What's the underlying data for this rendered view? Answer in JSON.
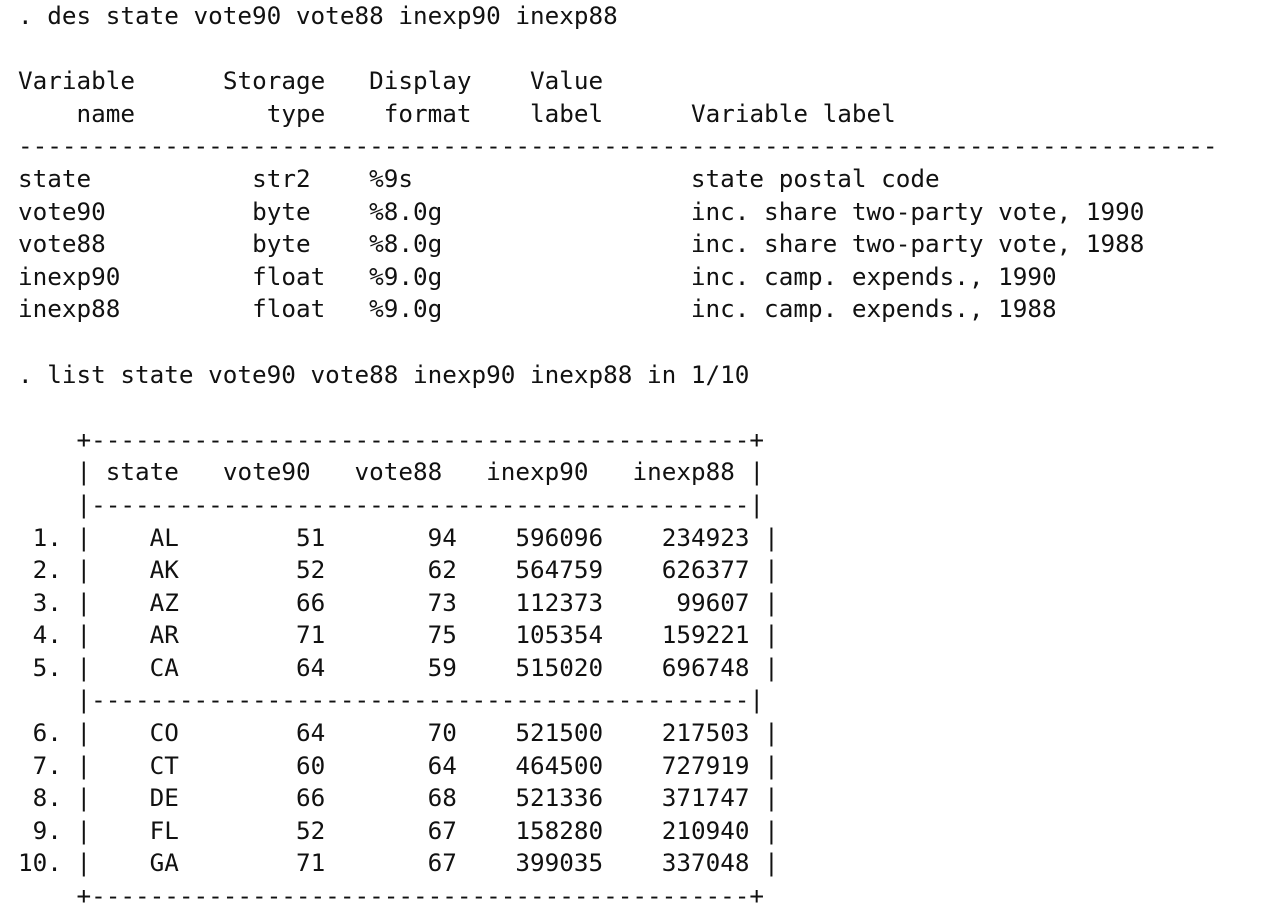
{
  "describe_command": ". des state vote90 vote88 inexp90 inexp88",
  "describe_table": {
    "headers": {
      "variable_name": [
        "Variable",
        "name"
      ],
      "storage_type": [
        "Storage",
        "type"
      ],
      "display_format": [
        "Display",
        "format"
      ],
      "value_label": [
        "Value",
        "label"
      ],
      "variable_label": [
        "",
        "Variable label"
      ]
    },
    "rows": [
      {
        "name": "state",
        "type": "str2",
        "format": "%9s",
        "value_label": "",
        "label": "state postal code"
      },
      {
        "name": "vote90",
        "type": "byte",
        "format": "%8.0g",
        "value_label": "",
        "label": "inc. share two-party vote, 1990"
      },
      {
        "name": "vote88",
        "type": "byte",
        "format": "%8.0g",
        "value_label": "",
        "label": "inc. share two-party vote, 1988"
      },
      {
        "name": "inexp90",
        "type": "float",
        "format": "%9.0g",
        "value_label": "",
        "label": "inc. camp. expends., 1990"
      },
      {
        "name": "inexp88",
        "type": "float",
        "format": "%9.0g",
        "value_label": "",
        "label": "inc. camp. expends., 1988"
      }
    ]
  },
  "list_command": ". list state vote90 vote88 inexp90 inexp88 in 1/10",
  "list_table": {
    "columns": [
      "state",
      "vote90",
      "vote88",
      "inexp90",
      "inexp88"
    ],
    "rows": [
      {
        "obs": "1.",
        "state": "AL",
        "vote90": "51",
        "vote88": "94",
        "inexp90": "596096",
        "inexp88": "234923"
      },
      {
        "obs": "2.",
        "state": "AK",
        "vote90": "52",
        "vote88": "62",
        "inexp90": "564759",
        "inexp88": "626377"
      },
      {
        "obs": "3.",
        "state": "AZ",
        "vote90": "66",
        "vote88": "73",
        "inexp90": "112373",
        "inexp88": "99607"
      },
      {
        "obs": "4.",
        "state": "AR",
        "vote90": "71",
        "vote88": "75",
        "inexp90": "105354",
        "inexp88": "159221"
      },
      {
        "obs": "5.",
        "state": "CA",
        "vote90": "64",
        "vote88": "59",
        "inexp90": "515020",
        "inexp88": "696748"
      },
      {
        "obs": "6.",
        "state": "CO",
        "vote90": "64",
        "vote88": "70",
        "inexp90": "521500",
        "inexp88": "217503"
      },
      {
        "obs": "7.",
        "state": "CT",
        "vote90": "60",
        "vote88": "64",
        "inexp90": "464500",
        "inexp88": "727919"
      },
      {
        "obs": "8.",
        "state": "DE",
        "vote90": "66",
        "vote88": "68",
        "inexp90": "521336",
        "inexp88": "371747"
      },
      {
        "obs": "9.",
        "state": "FL",
        "vote90": "52",
        "vote88": "67",
        "inexp90": "158280",
        "inexp88": "210940"
      },
      {
        "obs": "10.",
        "state": "GA",
        "vote90": "71",
        "vote88": "67",
        "inexp90": "399035",
        "inexp88": "337048"
      }
    ]
  }
}
